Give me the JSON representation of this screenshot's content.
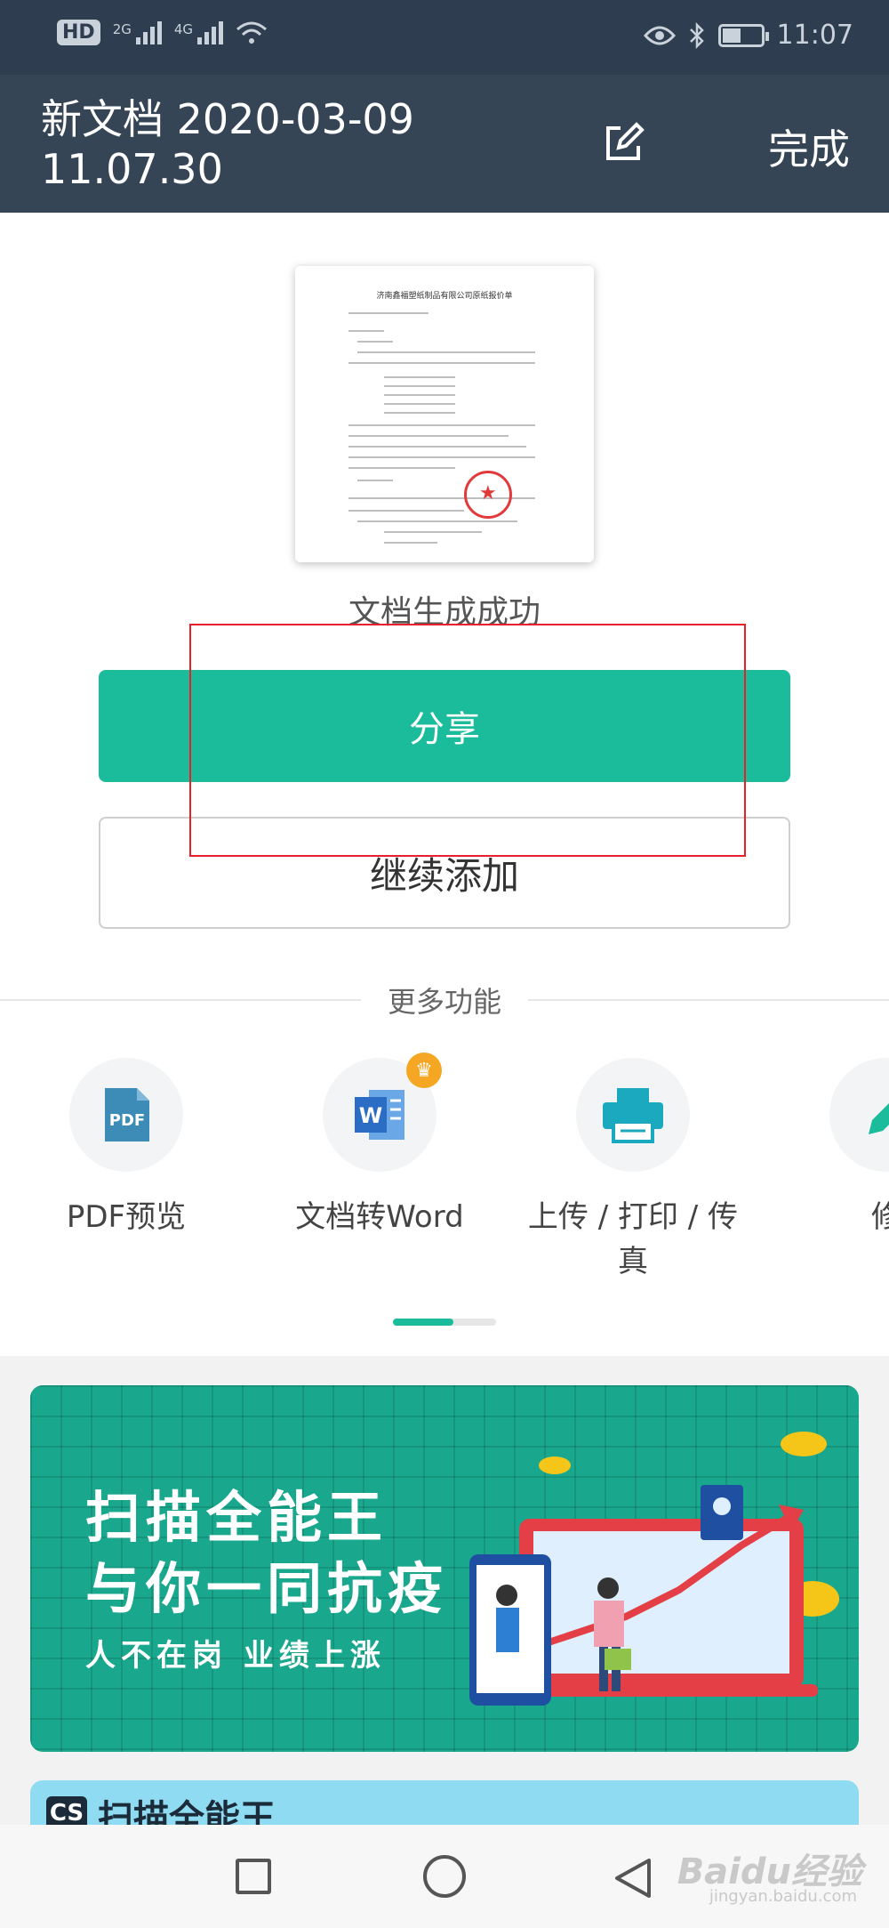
{
  "status_bar": {
    "hd": "HD",
    "net1": "2G",
    "net2": "4G",
    "time": "11:07",
    "battery_level": 0.45
  },
  "header": {
    "title": "新文档 2020-03-09 11.07.30",
    "done_label": "完成"
  },
  "document": {
    "thumb_title": "济南鑫福塑纸制品有限公司原纸报价单"
  },
  "result": {
    "success_text": "文档生成成功",
    "share_label": "分享",
    "continue_label": "继续添加"
  },
  "more": {
    "label": "更多功能",
    "features": [
      {
        "label": "PDF预览",
        "icon": "pdf-icon"
      },
      {
        "label": "文档转Word",
        "icon": "word-icon"
      },
      {
        "label": "上传 / 打印 / 传真",
        "icon": "printer-icon"
      },
      {
        "label": "修",
        "icon": "pencil-icon"
      }
    ],
    "page_progress": 0.59
  },
  "banner": {
    "line1": "扫描全能王",
    "line2": "与你一同抗疫",
    "line3": "人不在岗 业绩上涨"
  },
  "banner2": {
    "logo": "CS",
    "text": "扫描全能王"
  },
  "watermark": {
    "text": "Baidu经验",
    "sub": "jingyan.baidu.com"
  },
  "colors": {
    "accent": "#1bbc9b",
    "header": "#354556",
    "highlight": "#e8202a"
  }
}
